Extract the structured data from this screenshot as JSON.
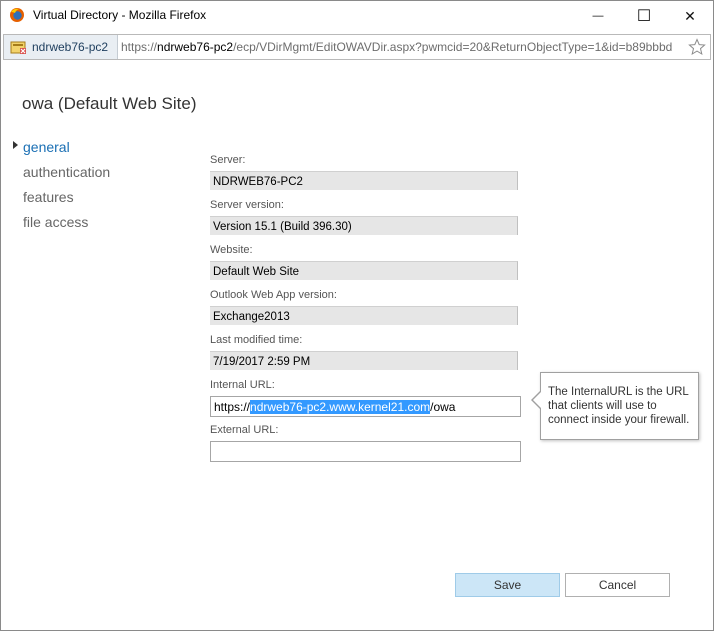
{
  "window": {
    "title": "Virtual Directory - Mozilla Firefox",
    "minimize_glyph": "—",
    "maximize_glyph": "☐",
    "close_glyph": "✕"
  },
  "urlbar": {
    "site_identity": "ndrweb76-pc2",
    "url_prefix": "https://",
    "url_host": "ndrweb76-pc2",
    "url_path": "/ecp/VDirMgmt/EditOWAVDir.aspx?pwmcid=20&ReturnObjectType=1&id=b89bbbd"
  },
  "page": {
    "title": "owa (Default Web Site)"
  },
  "nav": {
    "items": [
      {
        "label": "general",
        "active": true
      },
      {
        "label": "authentication",
        "active": false
      },
      {
        "label": "features",
        "active": false
      },
      {
        "label": "file access",
        "active": false
      }
    ]
  },
  "form": {
    "server": {
      "label": "Server:",
      "value": "NDRWEB76-PC2"
    },
    "server_version": {
      "label": "Server version:",
      "value": "Version 15.1 (Build 396.30)"
    },
    "website": {
      "label": "Website:",
      "value": "Default Web Site"
    },
    "owa_version": {
      "label": "Outlook Web App version:",
      "value": "Exchange2013"
    },
    "last_modified": {
      "label": "Last modified time:",
      "value": "7/19/2017 2:59 PM"
    },
    "internal_url": {
      "label": "Internal URL:",
      "value_before": "https://",
      "value_selected": "ndrweb76-pc2.www.kernel21.com",
      "value_after": "/owa"
    },
    "external_url": {
      "label": "External URL:",
      "value": ""
    }
  },
  "tooltip": {
    "text": "The InternalURL is the URL that clients will use to connect inside your firewall."
  },
  "buttons": {
    "save": "Save",
    "cancel": "Cancel"
  },
  "colors": {
    "accent": "#1a6fb4",
    "selection": "#3399ff",
    "save_button_bg": "#cce6f7"
  }
}
